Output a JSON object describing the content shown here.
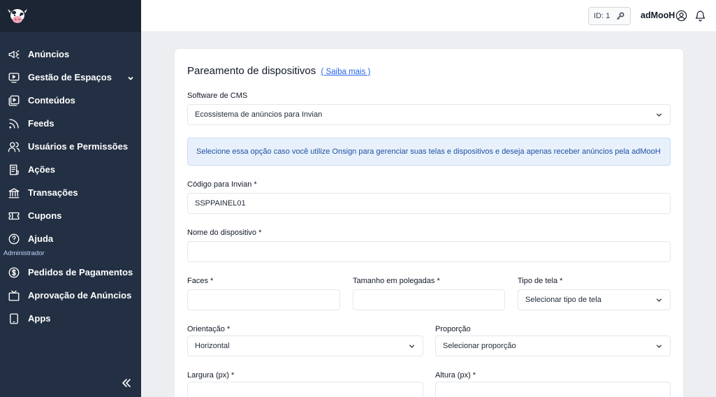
{
  "sidebar": {
    "items": [
      {
        "label": "Anúncios",
        "icon": "megaphone-icon"
      },
      {
        "label": "Gestão de Espaços",
        "icon": "monitor-play-icon",
        "expandable": true
      },
      {
        "label": "Conteúdos",
        "icon": "media-library-icon"
      },
      {
        "label": "Feeds",
        "icon": "rss-icon"
      },
      {
        "label": "Usuários e Permissões",
        "icon": "users-icon"
      },
      {
        "label": "Ações",
        "icon": "list-document-icon"
      },
      {
        "label": "Transações",
        "icon": "bank-icon"
      },
      {
        "label": "Cupons",
        "icon": "ticket-icon"
      },
      {
        "label": "Ajuda",
        "icon": "help-circle-icon"
      }
    ],
    "section_label": "Administrador",
    "admin_items": [
      {
        "label": "Pedidos de Pagamentos",
        "icon": "dollar-circle-icon"
      },
      {
        "label": "Aprovação de Anúncios",
        "icon": "tv-icon"
      },
      {
        "label": "Apps",
        "icon": "tablet-icon"
      }
    ]
  },
  "header": {
    "id_label": "ID: 1",
    "username": "adMooH"
  },
  "form": {
    "title": "Pareamento de dispositivos",
    "learn_more": "( Saiba mais )",
    "cms_label": "Software de CMS",
    "cms_value": "Ecossistema de anúncios para Invian",
    "info_text": "Selecione essa opção caso você utilize Onsign para gerenciar suas telas e dispositivos e deseja apenas receber anúncios pela adMooH",
    "code_label": "Código para Invian *",
    "code_value": "SSPPAINEL01",
    "name_label": "Nome do dispositivo *",
    "name_value": "",
    "faces_label": "Faces *",
    "faces_value": "",
    "size_label": "Tamanho em polegadas *",
    "size_value": "",
    "screen_type_label": "Tipo de tela *",
    "screen_type_value": "Selecionar tipo de tela",
    "orientation_label": "Orientação *",
    "orientation_value": "Horizontal",
    "ratio_label": "Proporção",
    "ratio_value": "Selecionar proporção",
    "width_label": "Largura (px) *",
    "width_value": "",
    "height_label": "Altura (px) *",
    "height_value": ""
  },
  "colors": {
    "sidebar_bg": "#233043",
    "sidebar_top_bg": "#1b2534",
    "accent_link": "#2563eb",
    "info_bg": "#e8f1fb",
    "info_text": "#1e4fa3"
  }
}
